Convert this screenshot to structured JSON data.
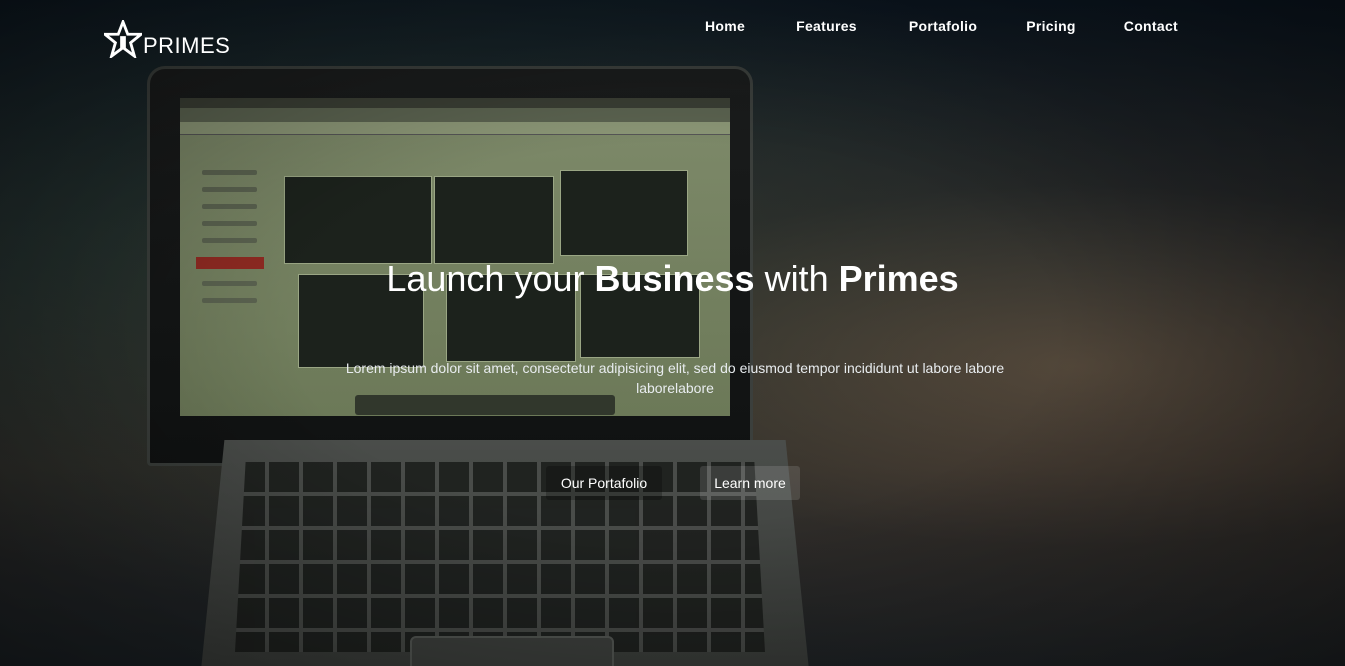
{
  "brand": {
    "name": "PRIMES",
    "logo_icon": "star-icon"
  },
  "nav": {
    "items": [
      {
        "label": "Home"
      },
      {
        "label": "Features"
      },
      {
        "label": "Portafolio"
      },
      {
        "label": "Pricing"
      },
      {
        "label": "Contact"
      }
    ]
  },
  "hero": {
    "headline_part1": "Launch your ",
    "headline_bold1": "Business",
    "headline_part2": " with ",
    "headline_bold2": "Primes",
    "subtext": "Lorem ipsum dolor sit amet, consectetur adipisicing elit, sed do eiusmod tempor incididunt ut labore labore laborelabore",
    "buttons": {
      "portfolio_label": "Our Portafolio",
      "learn_label": "Learn more"
    }
  },
  "colors": {
    "text": "#ffffff",
    "background_dark": "#0a0f17"
  }
}
